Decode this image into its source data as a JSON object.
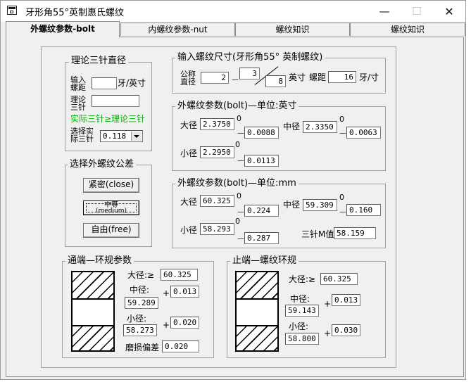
{
  "window": {
    "title": "牙形角55°英制惠氏螺纹",
    "min_glyph": "—",
    "max_glyph": "☐",
    "close_glyph": "✕"
  },
  "tabs": [
    "外螺纹参数-bolt",
    "内螺纹参数-nut",
    "螺纹知识",
    "螺纹知识"
  ],
  "three_wire": {
    "title": "理论三针直径",
    "pitch_label_1": "输入",
    "pitch_label_2": "螺距",
    "pitch_value": "",
    "pitch_unit": "牙/英寸",
    "theory_label_1": "理论",
    "theory_label_2": "三针",
    "theory_value": "",
    "note": "实际三针≥理论三针",
    "select_label_1": "选择实",
    "select_label_2": "际三针",
    "select_value": "0.118"
  },
  "tolerance": {
    "title": "选择外螺纹公差",
    "close_label": "紧密(close)",
    "medium_label_1": "中等",
    "medium_label_2": "(medium)",
    "free_label": "自由(free)"
  },
  "input_size": {
    "title": "输入螺纹尺寸(牙形角55° 英制螺纹)",
    "nominal_1": "公称",
    "nominal_2": "直径",
    "whole": "2",
    "dash": "—",
    "numerator": "3",
    "denominator": "8",
    "inch_label": "英寸",
    "pitch_label": "螺距",
    "pitch_value": "16",
    "pitch_unit": "牙/寸"
  },
  "bolt_inch": {
    "title": "外螺纹参数(bolt)—单位:英寸",
    "major_label": "大径",
    "major_value": "2.3750",
    "major_upper": "0",
    "major_lower": "0.0088",
    "pitch_label": "中径",
    "pitch_value": "2.3350",
    "pitch_upper": "0",
    "pitch_lower": "0.0063",
    "minor_label": "小径",
    "minor_value": "2.2950",
    "minor_upper": "0",
    "minor_lower": "0.0113"
  },
  "bolt_mm": {
    "title": "外螺纹参数(bolt)—单位:mm",
    "major_label": "大径",
    "major_value": "60.325",
    "major_upper": "0",
    "major_lower": "0.224",
    "pitch_label": "中径",
    "pitch_value": "59.309",
    "pitch_upper": "0",
    "pitch_lower": "0.160",
    "minor_label": "小径",
    "minor_value": "58.293",
    "minor_upper": "0",
    "minor_lower": "0.287",
    "m_label": "三针M值",
    "m_value": "58.159"
  },
  "go_gauge": {
    "title": "通端—环规参数",
    "major_label": "大径:≥",
    "major_value": "60.325",
    "pitch_label": "中径:",
    "pitch_value": "59.289",
    "pitch_tol": "0.013",
    "minor_label": "小径:",
    "minor_value": "58.273",
    "minor_tol": "0.020",
    "wear_label": "磨损偏差",
    "wear_value": "0.020",
    "plus": "+"
  },
  "nogo_gauge": {
    "title": "止端—螺纹环规",
    "major_label": "大径:≥",
    "major_value": "60.325",
    "pitch_label": "中径:",
    "pitch_value": "59.143",
    "pitch_tol": "0.013",
    "minor_label": "小径:",
    "minor_value": "58.800",
    "minor_tol": "0.030",
    "plus": "+"
  }
}
